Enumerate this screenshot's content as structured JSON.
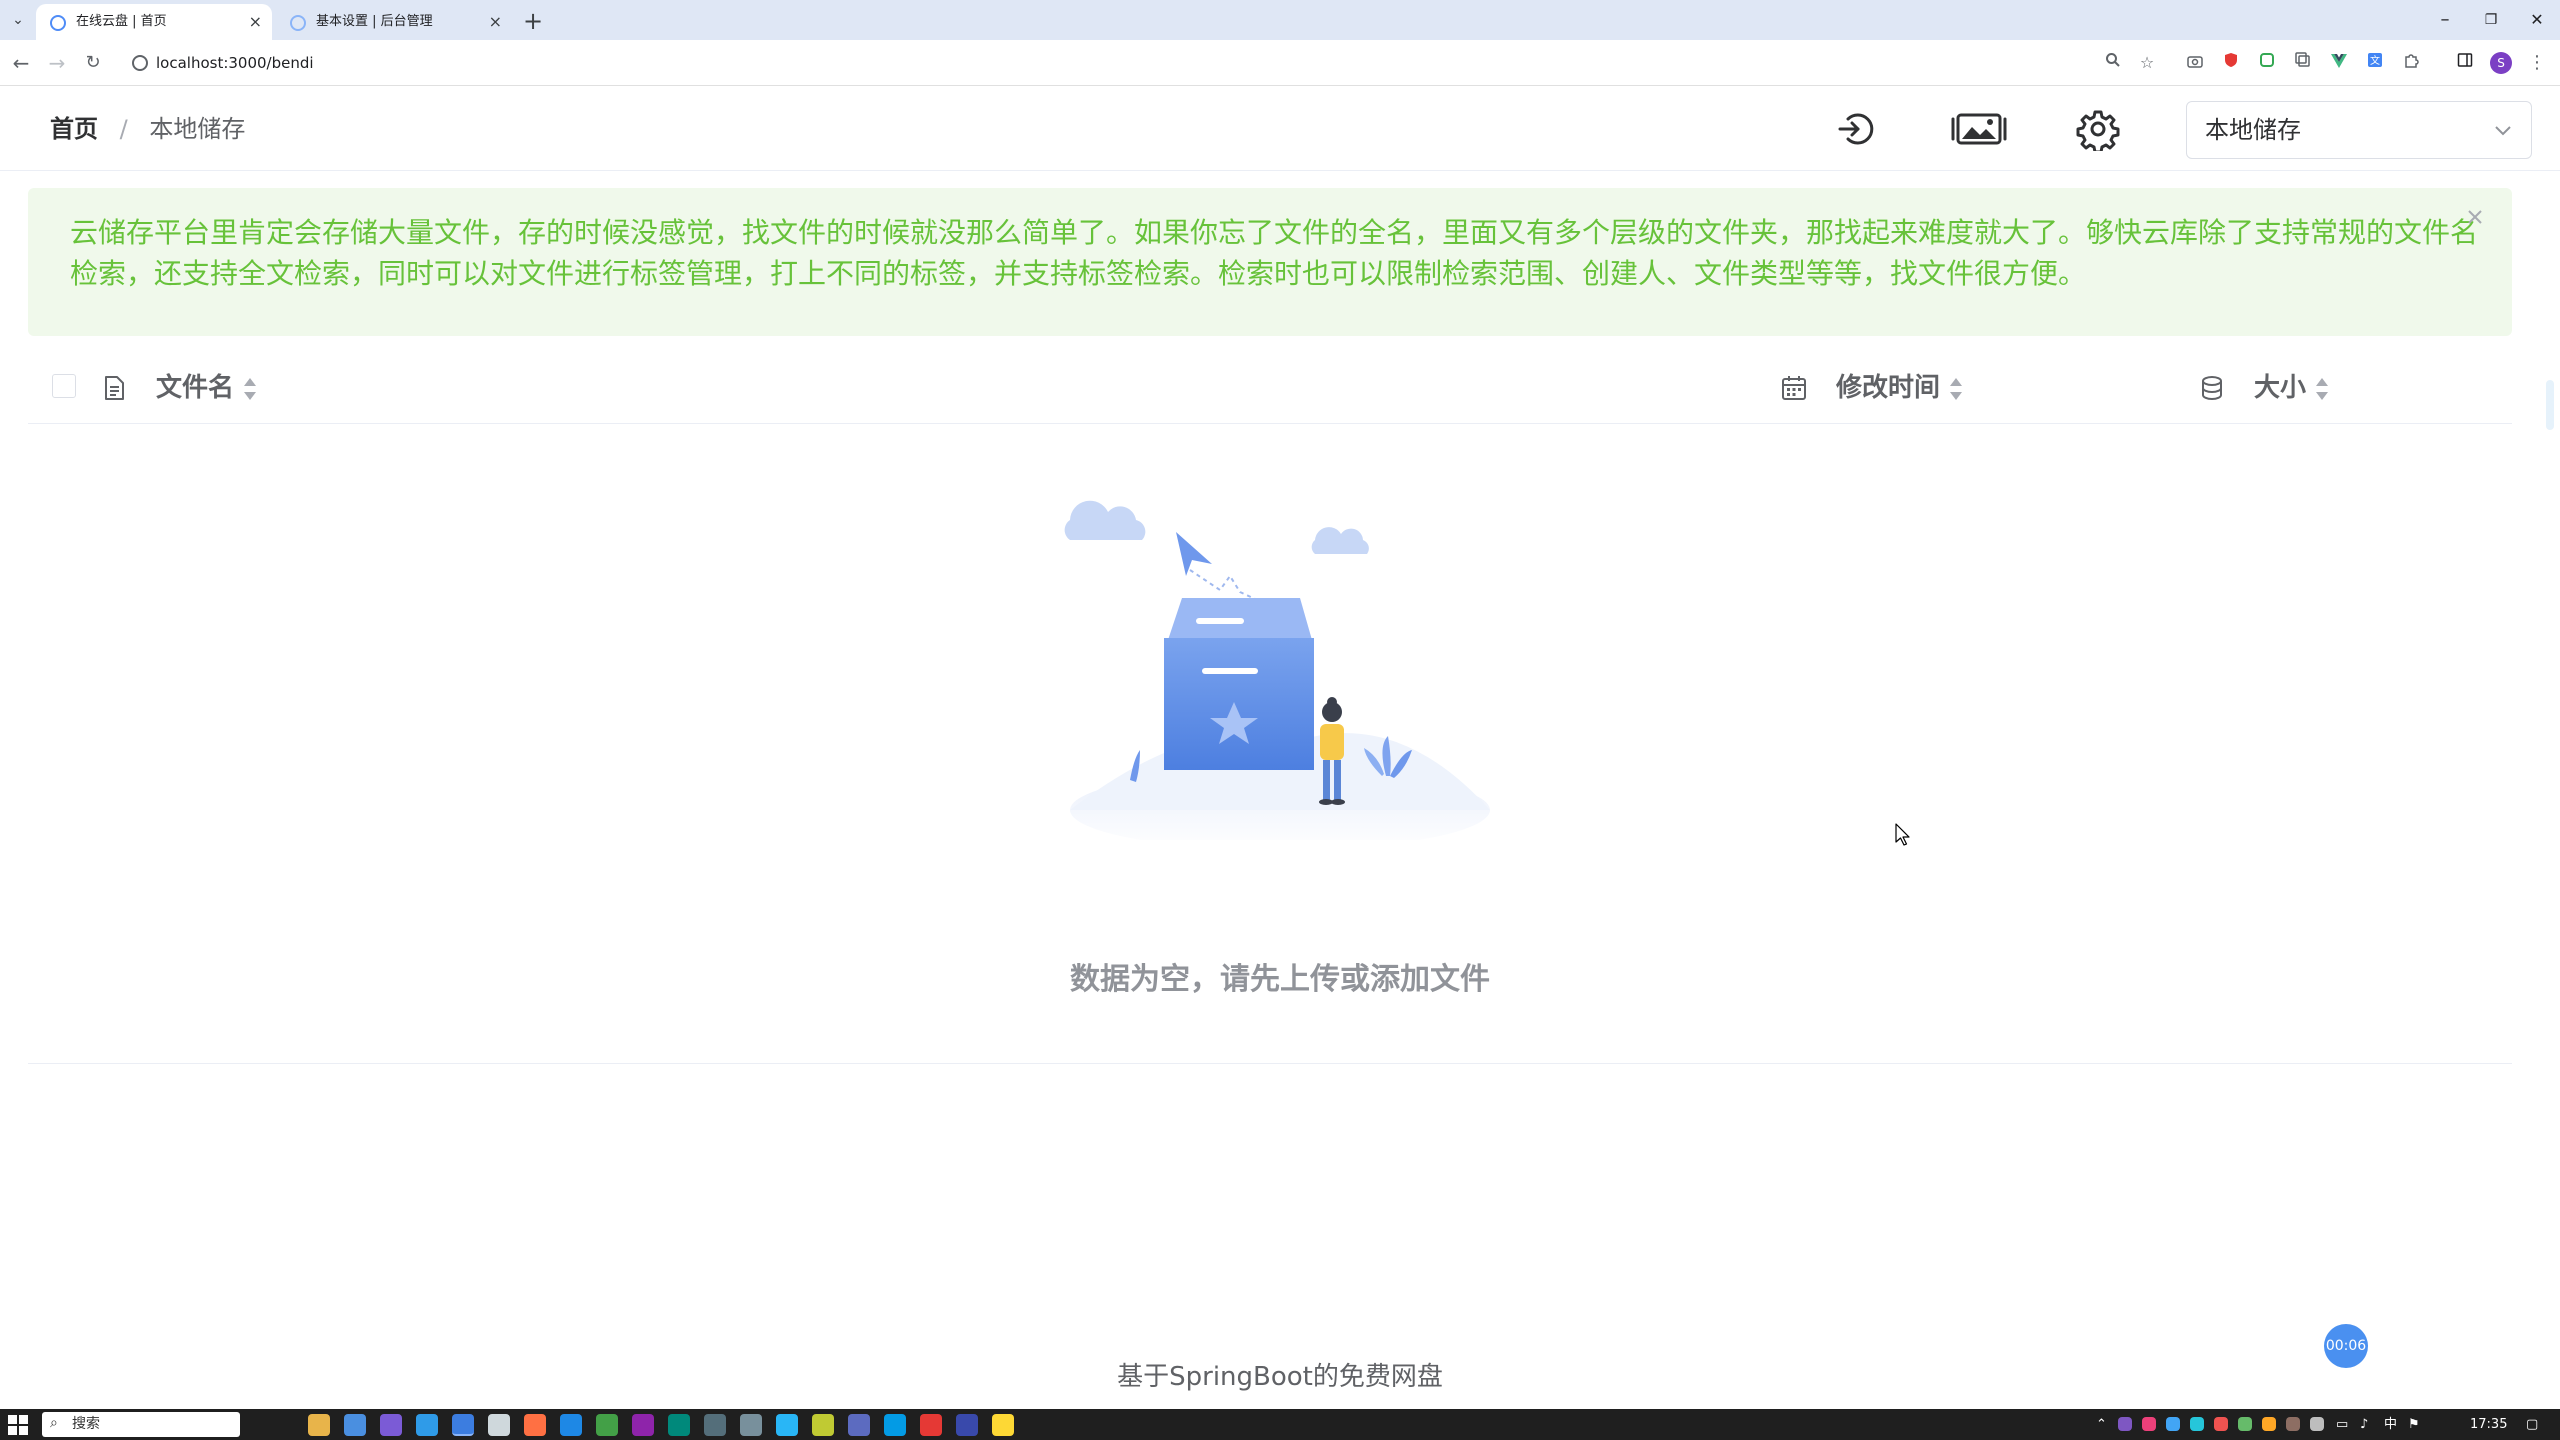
{
  "browser": {
    "tabs": [
      {
        "title": "在线云盘 | 首页",
        "active": true
      },
      {
        "title": "基本设置 | 后台管理",
        "active": false
      }
    ],
    "close_glyph": "×",
    "new_tab_glyph": "+",
    "url": "localhost:3000/bendi",
    "profile_initial": "S",
    "window": {
      "minimize": "–",
      "maximize": "❐",
      "close": "✕"
    }
  },
  "header": {
    "breadcrumb": {
      "home": "首页",
      "separator": "/",
      "current": "本地储存"
    },
    "icons": [
      "logout-icon",
      "gallery-icon",
      "settings-icon"
    ],
    "storage_select": {
      "value": "本地储存"
    }
  },
  "notice": {
    "text": "云储存平台里肯定会存储大量文件，存的时候没感觉，找文件的时候就没那么简单了。如果你忘了文件的全名，里面又有多个层级的文件夹，那找起来难度就大了。够快云库除了支持常规的文件名检索，还支持全文检索，同时可以对文件进行标签管理，打上不同的标签，并支持标签检索。检索时也可以限制检索范围、创建人、文件类型等等，找文件很方便。",
    "color": "#67c23a",
    "background": "#f0f9eb"
  },
  "table": {
    "columns": {
      "name": "文件名",
      "modified": "修改时间",
      "size": "大小"
    },
    "empty_text": "数据为空，请先上传或添加文件"
  },
  "footer": {
    "text": "基于SpringBoot的免费网盘"
  },
  "timer": {
    "text": "00:06"
  },
  "taskbar": {
    "search_placeholder": "搜索",
    "ime": "中",
    "time": "17:35"
  },
  "colors": {
    "accent": "#409eff",
    "primary_text": "#303133",
    "muted_text": "#909399"
  }
}
